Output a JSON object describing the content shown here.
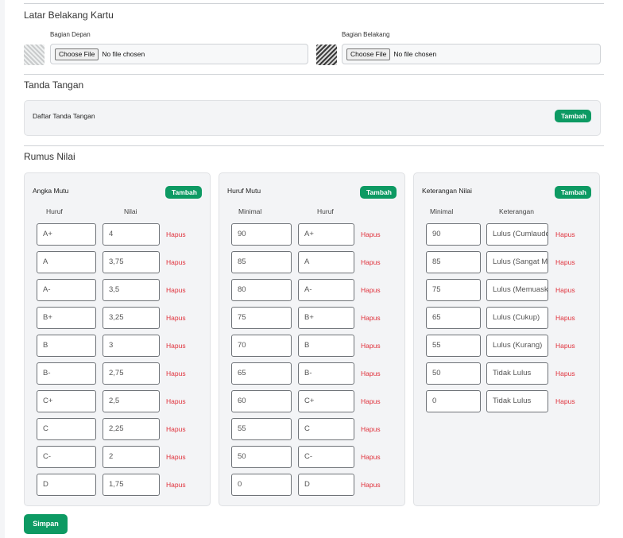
{
  "background_section": {
    "title": "Latar Belakang Kartu",
    "front": {
      "label": "Bagian Depan",
      "button": "Choose File",
      "status": "No file chosen"
    },
    "back": {
      "label": "Bagian Belakang",
      "button": "Choose File",
      "status": "No file chosen"
    }
  },
  "signature_section": {
    "title": "Tanda Tangan",
    "list_title": "Daftar Tanda Tangan",
    "add_label": "Tambah"
  },
  "grade_section": {
    "title": "Rumus Nilai",
    "delete_label": "Hapus",
    "panels": [
      {
        "title": "Angka Mutu",
        "add_label": "Tambah",
        "headers": [
          "Huruf",
          "Nilai"
        ],
        "rows": [
          [
            "A+",
            "4"
          ],
          [
            "A",
            "3,75"
          ],
          [
            "A-",
            "3,5"
          ],
          [
            "B+",
            "3,25"
          ],
          [
            "B",
            "3"
          ],
          [
            "B-",
            "2,75"
          ],
          [
            "C+",
            "2,5"
          ],
          [
            "C",
            "2,25"
          ],
          [
            "C-",
            "2"
          ],
          [
            "D",
            "1,75"
          ]
        ]
      },
      {
        "title": "Huruf Mutu",
        "add_label": "Tambah",
        "headers": [
          "Minimal",
          "Huruf"
        ],
        "rows": [
          [
            "90",
            "A+"
          ],
          [
            "85",
            "A"
          ],
          [
            "80",
            "A-"
          ],
          [
            "75",
            "B+"
          ],
          [
            "70",
            "B"
          ],
          [
            "65",
            "B-"
          ],
          [
            "60",
            "C+"
          ],
          [
            "55",
            "C"
          ],
          [
            "50",
            "C-"
          ],
          [
            "0",
            "D"
          ]
        ]
      },
      {
        "title": "Keterangan Nilai",
        "add_label": "Tambah",
        "headers": [
          "Minimal",
          "Keterangan"
        ],
        "rows": [
          [
            "90",
            "Lulus (Cumlaude)"
          ],
          [
            "85",
            "Lulus (Sangat Memuaskan)"
          ],
          [
            "75",
            "Lulus (Memuaskan)"
          ],
          [
            "65",
            "Lulus (Cukup)"
          ],
          [
            "55",
            "Lulus (Kurang)"
          ],
          [
            "50",
            "Tidak Lulus"
          ],
          [
            "0",
            "Tidak Lulus"
          ]
        ]
      }
    ]
  },
  "save_label": "Simpan"
}
